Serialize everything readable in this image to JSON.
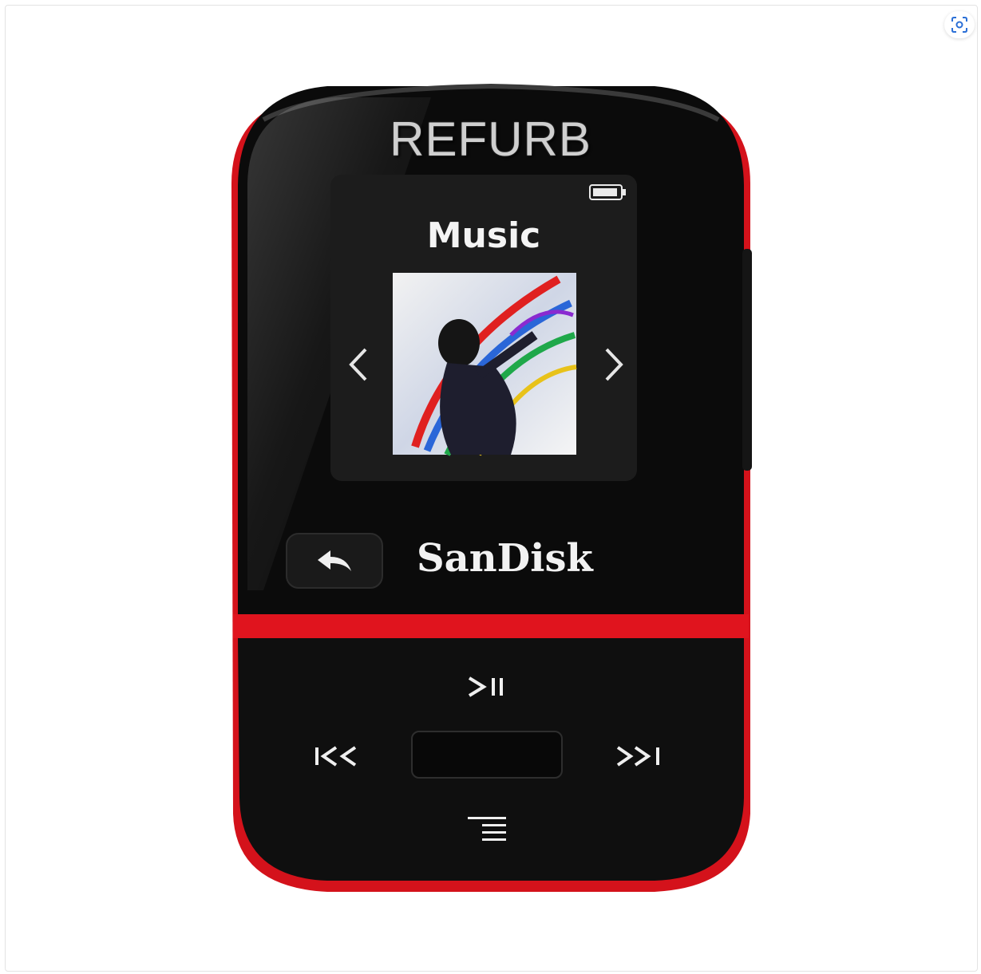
{
  "overlay_text": "REFURB",
  "screen": {
    "title": "Music",
    "battery_icon": "battery-icon",
    "prev_icon": "chevron-left-icon",
    "next_icon": "chevron-right-icon"
  },
  "device": {
    "brand": "SanDisk",
    "colors": {
      "body": "#0b0b0b",
      "accent": "#e0141e",
      "screen": "#1c1c1c"
    },
    "buttons": {
      "play_pause": "play-pause-icon",
      "previous": "previous-track-icon",
      "next": "next-track-icon",
      "menu": "menu-icon",
      "back": "back-arrow-icon",
      "select": "select-button"
    }
  },
  "toolbar": {
    "visual_search_icon": "visual-search-icon"
  }
}
